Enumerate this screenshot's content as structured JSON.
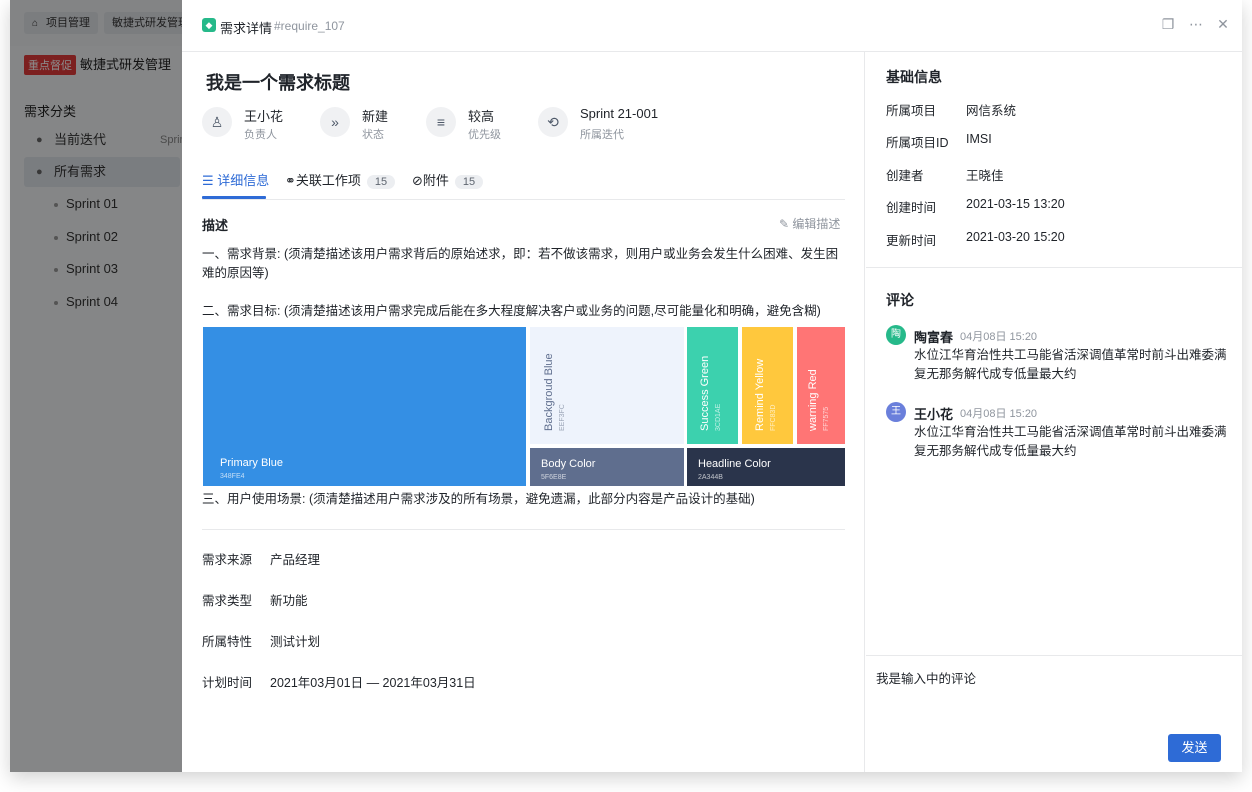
{
  "background": {
    "tabs": [
      {
        "label": "项目管理",
        "icon": "home-icon"
      },
      {
        "label": "敏捷式研发管理"
      }
    ],
    "project_badge": "重点督促",
    "project_name": "敏捷式研发管理",
    "sidebar_heading": "需求分类",
    "sidebar_items": [
      {
        "label": "当前迭代",
        "trail": "Sprin"
      },
      {
        "label": "所有需求"
      }
    ],
    "sprints": [
      "Sprint 01",
      "Sprint 02",
      "Sprint 03",
      "Sprint 04"
    ]
  },
  "drawer": {
    "header": {
      "title": "需求详情",
      "id": "#require_107"
    },
    "title": "我是一个需求标题",
    "meta": [
      {
        "value": "王小花",
        "key": "负责人",
        "icon": "user-icon"
      },
      {
        "value": "新建",
        "key": "状态",
        "icon": "status-icon"
      },
      {
        "value": "较高",
        "key": "优先级",
        "icon": "priority-icon"
      },
      {
        "value": "Sprint 21-001",
        "key": "所属迭代",
        "icon": "cycle-icon"
      }
    ],
    "tabs": [
      {
        "label": "详细信息"
      },
      {
        "label": "关联工作项",
        "count": "15"
      },
      {
        "label": "附件",
        "count": "15"
      }
    ],
    "description_label": "描述",
    "edit_label": "编辑描述",
    "paragraphs": [
      "一、需求背景: (须清楚描述该用户需求背后的原始述求，即：若不做该需求，则用户或业务会发生什么困难、发生困难的原因等)",
      "二、需求目标: (须清楚描述该用户需求完成后能在多大程度解决客户或业务的问题,尽可能量化和明确，避免含糊)",
      "三、用户使用场景: (须清楚描述用户需求涉及的所有场景，避免遗漏，此部分内容是产品设计的基础)"
    ],
    "swatches": [
      {
        "name": "Primary Blue",
        "code": "348FE4",
        "color": "#348FE4"
      },
      {
        "name": "Backgroud Blue",
        "code": "EEF3FC",
        "color": "#EEF3FC"
      },
      {
        "name": "Success Green",
        "code": "3CD1AE",
        "color": "#3CD1AE"
      },
      {
        "name": "Remind Yellow",
        "code": "FFC83D",
        "color": "#FFC83D"
      },
      {
        "name": "warning Red",
        "code": "FF7575",
        "color": "#FF7575"
      },
      {
        "name": "Body Color",
        "code": "5F6E8E",
        "color": "#5F6E8E"
      },
      {
        "name": "Headline Color",
        "code": "2A344B",
        "color": "#2A344B"
      }
    ],
    "fields": [
      {
        "key": "需求来源",
        "value": "产品经理"
      },
      {
        "key": "需求类型",
        "value": "新功能"
      },
      {
        "key": "所属特性",
        "value": "测试计划"
      },
      {
        "key": "计划时间",
        "value": "2021年03月01日 — 2021年03月31日"
      }
    ],
    "basic_info": {
      "heading": "基础信息",
      "rows": [
        {
          "key": "所属项目",
          "value": "网信系统"
        },
        {
          "key": "所属项目ID",
          "value": "IMSI"
        },
        {
          "key": "创建者",
          "value": "王晓佳"
        },
        {
          "key": "创建时间",
          "value": "2021-03-15 13:20"
        },
        {
          "key": "更新时间",
          "value": "2021-03-20 15:20"
        }
      ]
    },
    "comments": {
      "heading": "评论",
      "items": [
        {
          "avatar": "陶",
          "name": "陶富春",
          "time": "04月08日 15:20",
          "text": "水位江华育治性共工马能省活深调值革常时前斗出难委满复无那务解代成专低量最大约",
          "color": "#26b98a"
        },
        {
          "avatar": "王",
          "name": "王小花",
          "time": "04月08日 15:20",
          "text": "水位江华育治性共工马能省活深调值革常时前斗出难委满复无那务解代成专低量最大约",
          "color": "#6a7fdb"
        }
      ],
      "input_value": "我是输入中的评论",
      "send_label": "发送"
    }
  }
}
